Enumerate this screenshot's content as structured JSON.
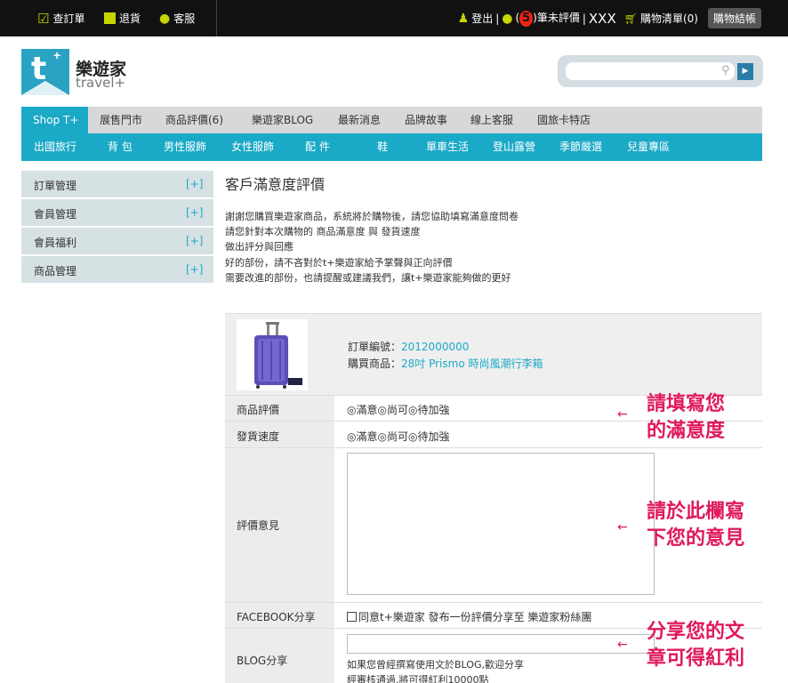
{
  "topbar": {
    "orders": "查訂單",
    "returns": "退貨",
    "service": "客服",
    "logout": "登出",
    "pending_prefix": "(",
    "pending_count": "5",
    "pending_suffix": ")筆未評價",
    "username": "XXX",
    "cart_label": "購物清單(",
    "cart_count": "0",
    "cart_suffix": ")",
    "checkout": "購物結帳"
  },
  "brand": {
    "logo_letter": "t",
    "logo_plus": "+",
    "name_cn": "樂遊家",
    "name_en": "travel+"
  },
  "search": {
    "placeholder": ""
  },
  "nav_primary": [
    "Shop T+",
    "展售門市",
    "商品評價(6)",
    "樂遊家BLOG",
    "最新消息",
    "品牌故事",
    "線上客服",
    "國旅卡特店"
  ],
  "nav_secondary": [
    "出國旅行",
    "背 包",
    "男性服飾",
    "女性服飾",
    "配 件",
    "鞋",
    "單車生活",
    "登山露營",
    "季節嚴選",
    "兒童專區"
  ],
  "sidebar": [
    {
      "label": "訂單管理",
      "toggle": "[+]"
    },
    {
      "label": "會員管理",
      "toggle": "[+]"
    },
    {
      "label": "會員福利",
      "toggle": "[+]"
    },
    {
      "label": "商品管理",
      "toggle": "[+]"
    }
  ],
  "page": {
    "title": "客戶滿意度評價",
    "intro": [
      "謝謝您購買樂遊家商品，系統將於購物後，請您協助填寫滿意度問卷",
      "請您針對本次購物的 商品滿意度 與 發貨速度",
      "做出評分與回應",
      "好的部份，請不吝對於t+樂遊家給予掌聲與正向評價",
      "需要改進的部份，也請提醒或建議我們，讓t+樂遊家能夠做的更好"
    ]
  },
  "order": {
    "number_label": "訂單編號：",
    "number": "2012000000",
    "product_label": "購買商品：",
    "product": "28吋 Prismo 時尚風潮行李箱"
  },
  "form": {
    "rating_label": "商品評價",
    "speed_label": "發貨速度",
    "options": [
      "滿意",
      "尚可",
      "待加強"
    ],
    "comment_label": "評價意見",
    "facebook_label": "FACEBOOK分享",
    "facebook_text": "同意t+樂遊家 發布一份評價分享至 樂遊家粉絲團",
    "blog_label": "BLOG分享",
    "blog_note1": "如果您曾經撰寫使用文於BLOG,歡迎分享",
    "blog_note2": "經審核通過,將可得紅利10000點"
  },
  "annotations": {
    "a1_line1": "請填寫您",
    "a1_line2": "的滿意度",
    "a2_line1": "請於此欄寫",
    "a2_line2": "下您的意見",
    "a3_line1": "分享您的文",
    "a3_line2": "章可得紅利",
    "arrow": "←"
  },
  "colors": {
    "accent": "#1aa9c6",
    "annotation": "#e0195b",
    "topbar": "#111111"
  }
}
